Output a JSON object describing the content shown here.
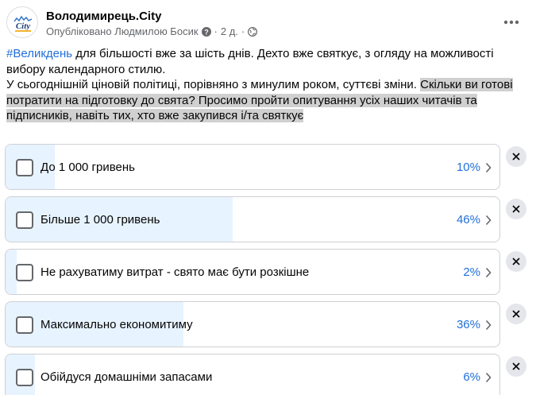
{
  "post": {
    "page_name": "Володимирець.City",
    "avatar_text": "City",
    "published_by": "Опубліковано Людмилою Босик",
    "time": "2 д.",
    "separator": "·",
    "hashtag": "#Великдень",
    "text_line1_rest": " для більшості вже за шість днів. Дехто вже святкує, з огляду на можливості вибору календарного стилю.",
    "text_line2_plain": "У сьогоднішній ціновій політиці, порівняно з минулим роком, суттєві зміни. ",
    "text_line2_highlight": "Скільки ви готові потратити на підготовку до свята? Просимо пройти опитування усіх наших читачів та підписників, навіть тих, хто вже закупився і/та святкує"
  },
  "poll": {
    "options": [
      {
        "label": "До 1 000 гривень",
        "percent_text": "10%",
        "percent": 10
      },
      {
        "label": "Більше 1 000 гривень",
        "percent_text": "46%",
        "percent": 46
      },
      {
        "label": "Не рахуватиму витрат - свято має бути розкішне",
        "percent_text": "2%",
        "percent": 2
      },
      {
        "label": "Максимально економитиму",
        "percent_text": "36%",
        "percent": 36
      },
      {
        "label": "Обійдуся домашніми запасами",
        "percent_text": "6%",
        "percent": 6
      }
    ]
  },
  "colors": {
    "accent": "#216fdb",
    "fill": "#e7f3ff",
    "highlight": "#d0d0d0"
  }
}
